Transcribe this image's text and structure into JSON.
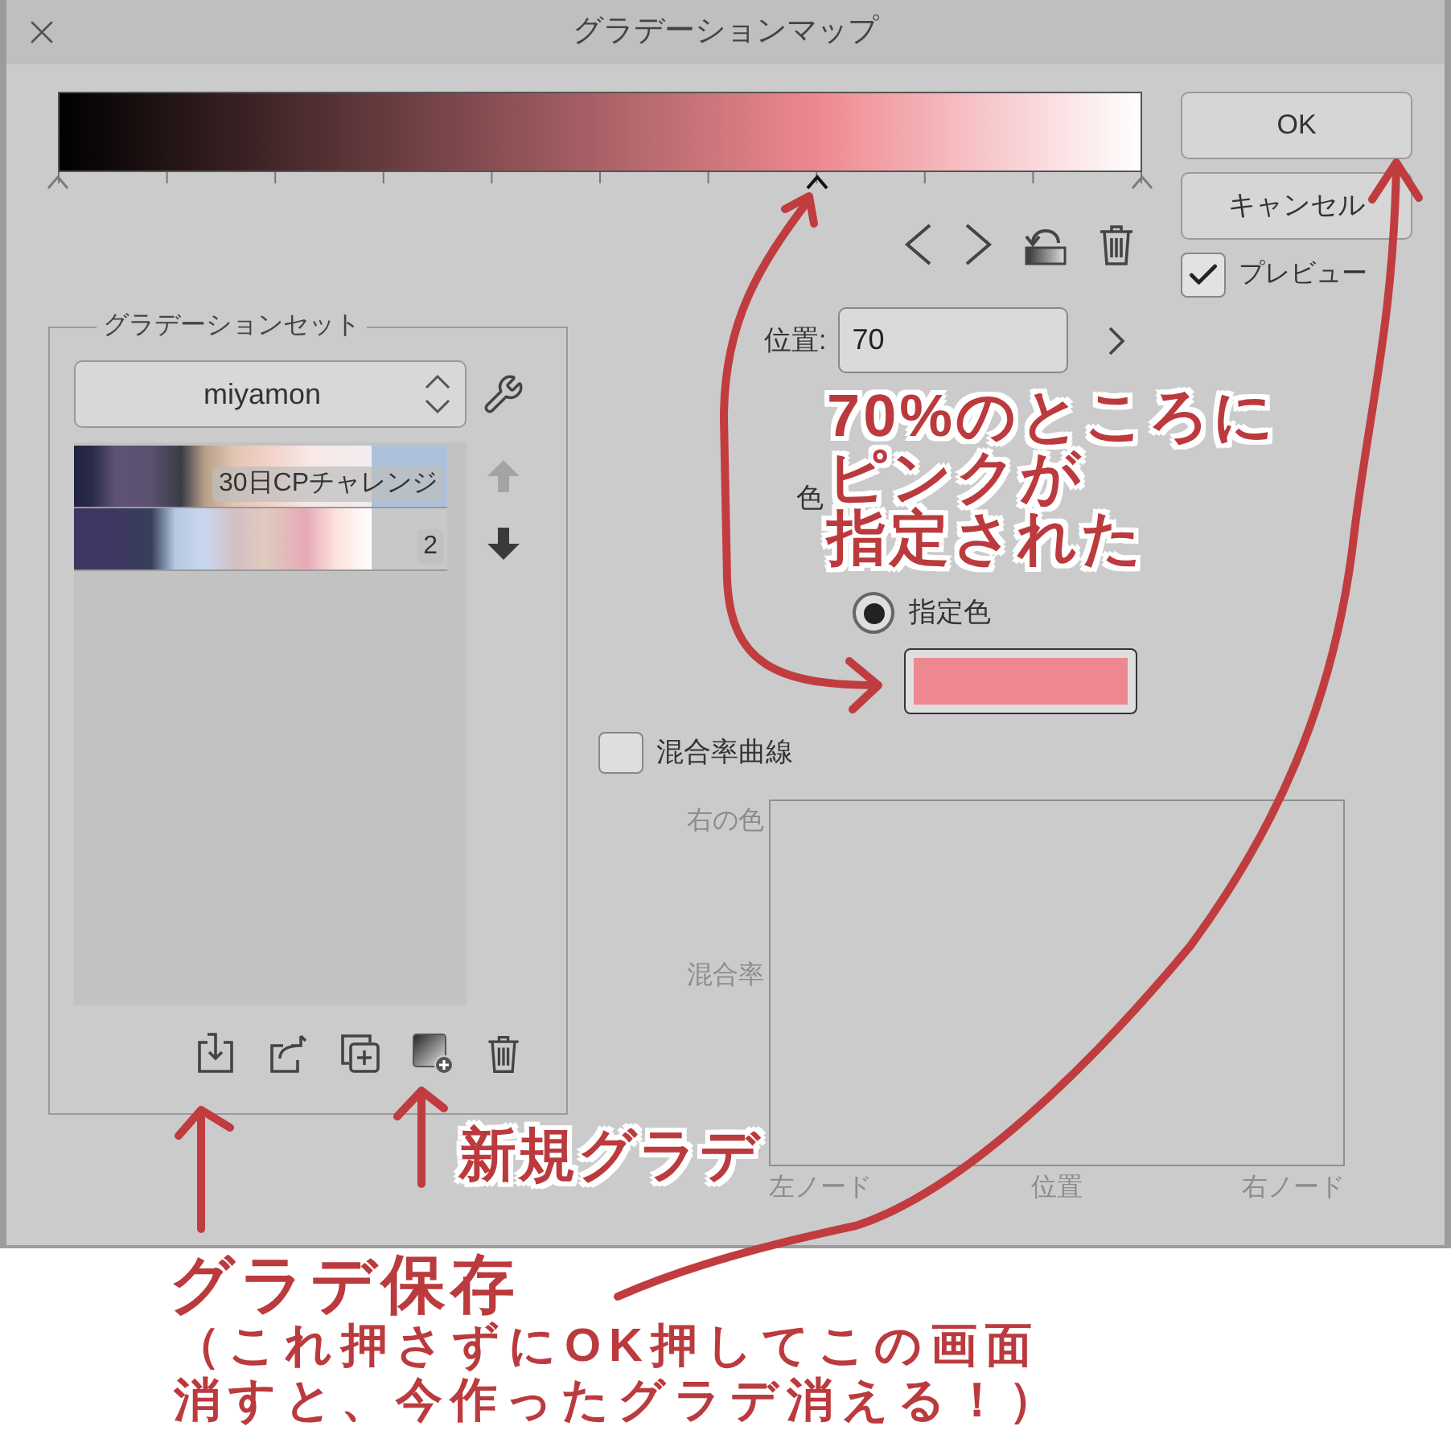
{
  "window": {
    "title": "グラデーションマップ"
  },
  "gradient_bar": {
    "nodes": [
      {
        "level": 0,
        "selected": false
      },
      {
        "level": 0.7,
        "selected": true
      },
      {
        "level": 1,
        "selected": false
      }
    ]
  },
  "buttons": [
    {
      "label": "OK"
    },
    {
      "label": "キャンセル"
    }
  ],
  "preview": {
    "label": "プレビュー",
    "checked": true
  },
  "gradient_set": {
    "title": "グラデーションセット",
    "dropdown": {
      "value": "miyamon"
    },
    "items": [
      {
        "name": "30日CPチャレンジ",
        "selected": true
      },
      {
        "name": "2",
        "selected": false
      }
    ],
    "move_up": {
      "disabled": true
    },
    "move_down": {
      "disabled": false
    }
  },
  "position": {
    "label": "位置:",
    "value": "70"
  },
  "color": {
    "label": "色",
    "options": [
      {
        "label": "指定色",
        "selected": true
      }
    ],
    "swatch": {
      "color": "#ee8890"
    }
  },
  "blend_curve": {
    "label": "混合率曲線",
    "checked": false,
    "y_labels": [
      "右の色",
      "混合率"
    ],
    "x_labels": [
      "左ノード",
      "位置",
      "右ノード"
    ]
  },
  "annotations": [
    {
      "lines": [
        "70%のところに",
        "ピンクが",
        "指定された"
      ]
    },
    {
      "lines": [
        "新規グラデ"
      ]
    },
    {
      "lines": [
        "グラデ保存"
      ]
    },
    {
      "lines": [
        "（これ押さずにOK押してこの画面",
        "消すと、今作ったグラデ消える！）"
      ]
    }
  ]
}
